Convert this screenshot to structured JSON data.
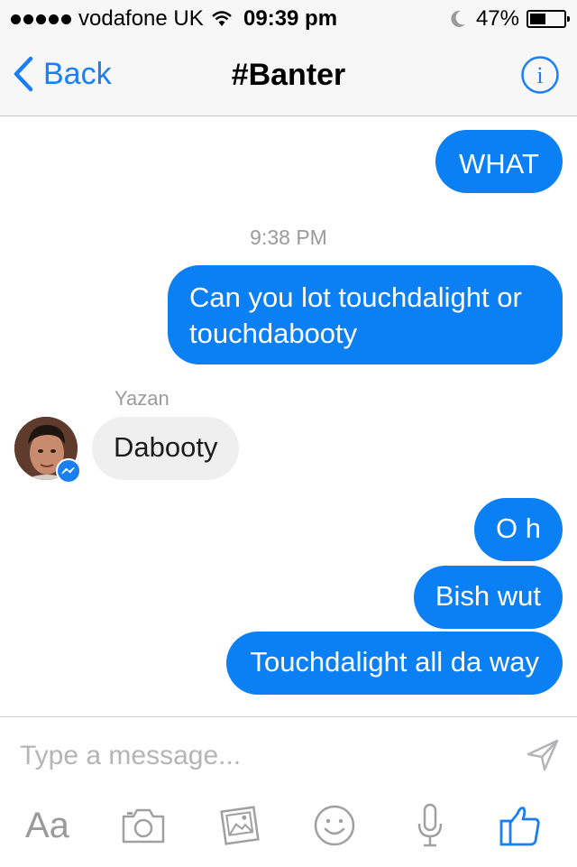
{
  "status": {
    "carrier": "vodafone UK",
    "time": "09:39 pm",
    "battery": "47%"
  },
  "nav": {
    "back_label": "Back",
    "title": "#Banter"
  },
  "thread": {
    "timestamp": "9:38 PM",
    "sender_name": "Yazan",
    "messages": [
      {
        "from": "me",
        "text": "WHAT"
      },
      {
        "from": "me",
        "text": "Can you lot touchdalight or touchdabooty"
      },
      {
        "from": "Yazan",
        "text": "Dabooty"
      },
      {
        "from": "me",
        "text": "O h"
      },
      {
        "from": "me",
        "text": "Bish wut"
      },
      {
        "from": "me",
        "text": "Touchdalight all da way"
      }
    ]
  },
  "composer": {
    "placeholder": "Type a message...",
    "aa_label": "Aa",
    "tools": [
      "text-format",
      "camera",
      "gallery",
      "emoji",
      "microphone",
      "like"
    ]
  },
  "colors": {
    "accent": "#0b7ff4",
    "incoming_bubble": "#f0eff0",
    "muted_text": "#9a9a9a"
  }
}
